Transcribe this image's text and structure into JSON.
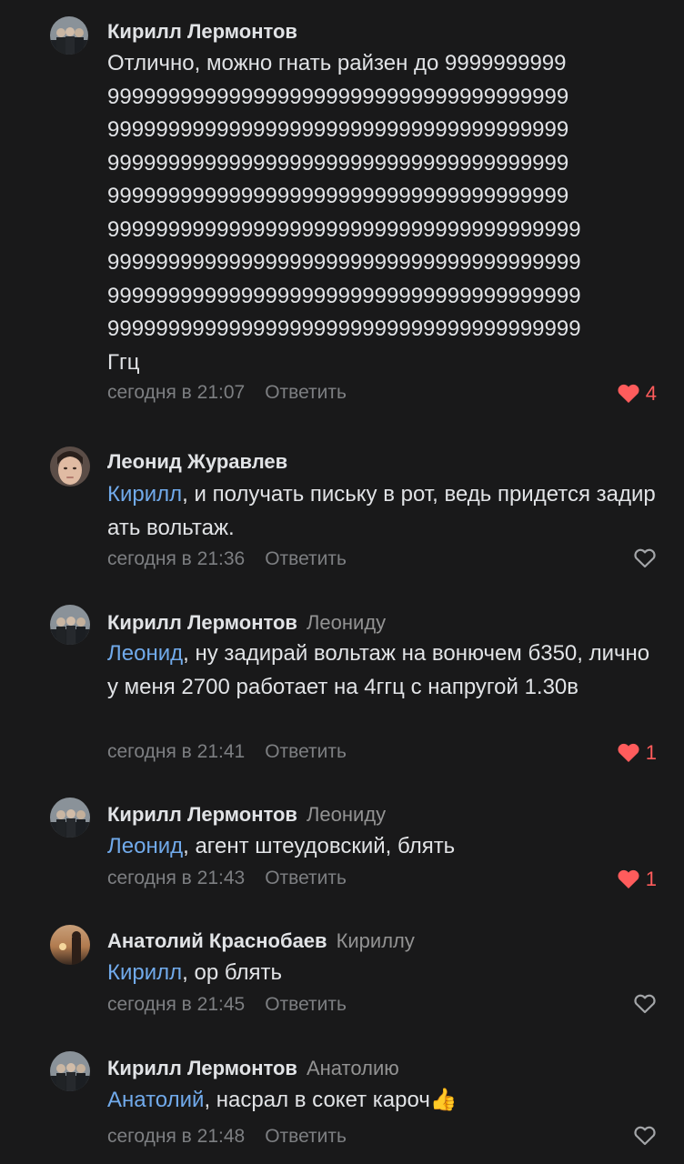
{
  "reply_label": "Ответить",
  "colors": {
    "background": "#19191a",
    "text": "#e1e3e6",
    "mention": "#71aaeb",
    "muted": "#7d7f82",
    "like_active": "#ff5c5c"
  },
  "comments": [
    {
      "author": "Кирилл Лермонтов",
      "reply_to": "",
      "mention": "",
      "text_lines": [
        "Отлично, можно гнать райзен до 9999999999",
        "99999999999999999999999999999999999999",
        "99999999999999999999999999999999999999",
        "99999999999999999999999999999999999999",
        "99999999999999999999999999999999999999",
        "999999999999999999999999999999999999999",
        "999999999999999999999999999999999999999",
        "999999999999999999999999999999999999999",
        "999999999999999999999999999999999999999",
        "Ггц"
      ],
      "time": "сегодня в 21:07",
      "likes": "4",
      "liked": true,
      "avatar_icon": "group-photo-avatar"
    },
    {
      "author": "Леонид Журавлев",
      "reply_to": "",
      "mention": "Кирилл",
      "text": ", и получать письку в рот, ведь придется задирать вольтаж.",
      "time": "сегодня в 21:36",
      "likes": "",
      "liked": false,
      "avatar_icon": "face-photo-avatar"
    },
    {
      "author": "Кирилл Лермонтов",
      "reply_to": "Леониду",
      "mention": "Леонид",
      "text": ", ну задирай вольтаж на вонючем б350, лично у меня 2700 работает на 4ггц с напругой 1.30в",
      "time": "сегодня в 21:41",
      "likes": "1",
      "liked": true,
      "avatar_icon": "group-photo-avatar"
    },
    {
      "author": "Кирилл Лермонтов",
      "reply_to": "Леониду",
      "mention": "Леонид",
      "text": ", агент штеудовский, блять",
      "time": "сегодня в 21:43",
      "likes": "1",
      "liked": true,
      "avatar_icon": "group-photo-avatar"
    },
    {
      "author": "Анатолий Краснобаев",
      "reply_to": "Кириллу",
      "mention": "Кирилл",
      "text": ", ор блять",
      "time": "сегодня в 21:45",
      "likes": "",
      "liked": false,
      "avatar_icon": "sunset-photo-avatar"
    },
    {
      "author": "Кирилл Лермонтов",
      "reply_to": "Анатолию",
      "mention": "Анатолий",
      "text": ", насрал в сокет кароч👍",
      "time": "сегодня в 21:48",
      "likes": "",
      "liked": false,
      "avatar_icon": "group-photo-avatar"
    }
  ]
}
